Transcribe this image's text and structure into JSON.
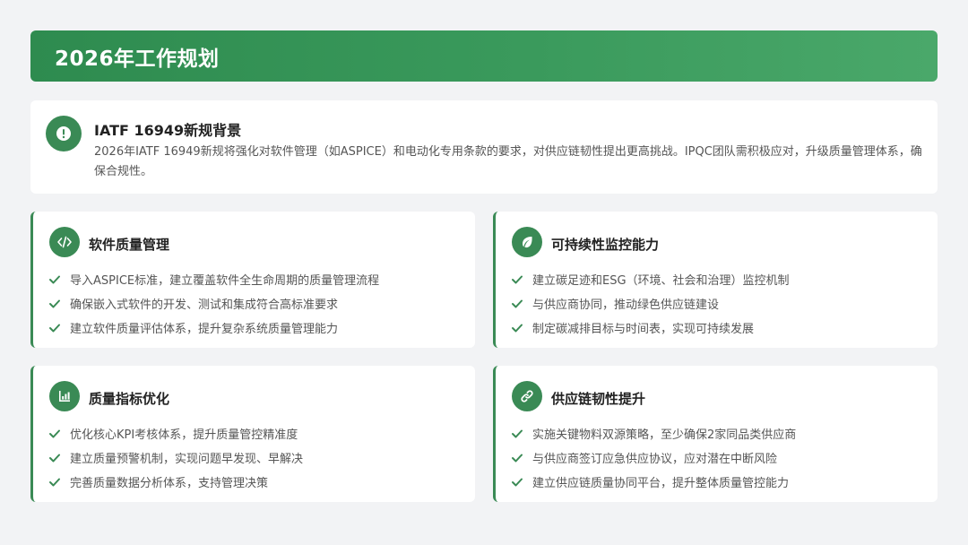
{
  "header": {
    "title": "2026年工作规划"
  },
  "background": {
    "title": "IATF 16949新规背景",
    "text": "2026年IATF 16949新规将强化对软件管理（如ASPICE）和电动化专用条款的要求，对供应链韧性提出更高挑战。IPQC团队需积极应对，升级质量管理体系，确保合规性。",
    "icon": "alert-icon"
  },
  "cards": [
    {
      "title": "软件质量管理",
      "icon": "code-icon",
      "items": [
        "导入ASPICE标准，建立覆盖软件全生命周期的质量管理流程",
        "确保嵌入式软件的开发、测试和集成符合高标准要求",
        "建立软件质量评估体系，提升复杂系统质量管理能力"
      ]
    },
    {
      "title": "可持续性监控能力",
      "icon": "leaf-icon",
      "items": [
        "建立碳足迹和ESG（环境、社会和治理）监控机制",
        "与供应商协同，推动绿色供应链建设",
        "制定碳减排目标与时间表，实现可持续发展"
      ]
    },
    {
      "title": "质量指标优化",
      "icon": "chart-icon",
      "items": [
        "优化核心KPI考核体系，提升质量管控精准度",
        "建立质量预警机制，实现问题早发现、早解决",
        "完善质量数据分析体系，支持管理决策"
      ]
    },
    {
      "title": "供应链韧性提升",
      "icon": "link-icon",
      "items": [
        "实施关键物料双源策略，至少确保2家同品类供应商",
        "与供应商签订应急供应协议，应对潜在中断风险",
        "建立供应链质量协同平台，提升整体质量管控能力"
      ]
    }
  ],
  "colors": {
    "accent": "#3a8a55",
    "header_start": "#2e8b4f",
    "header_end": "#4aa86a"
  }
}
